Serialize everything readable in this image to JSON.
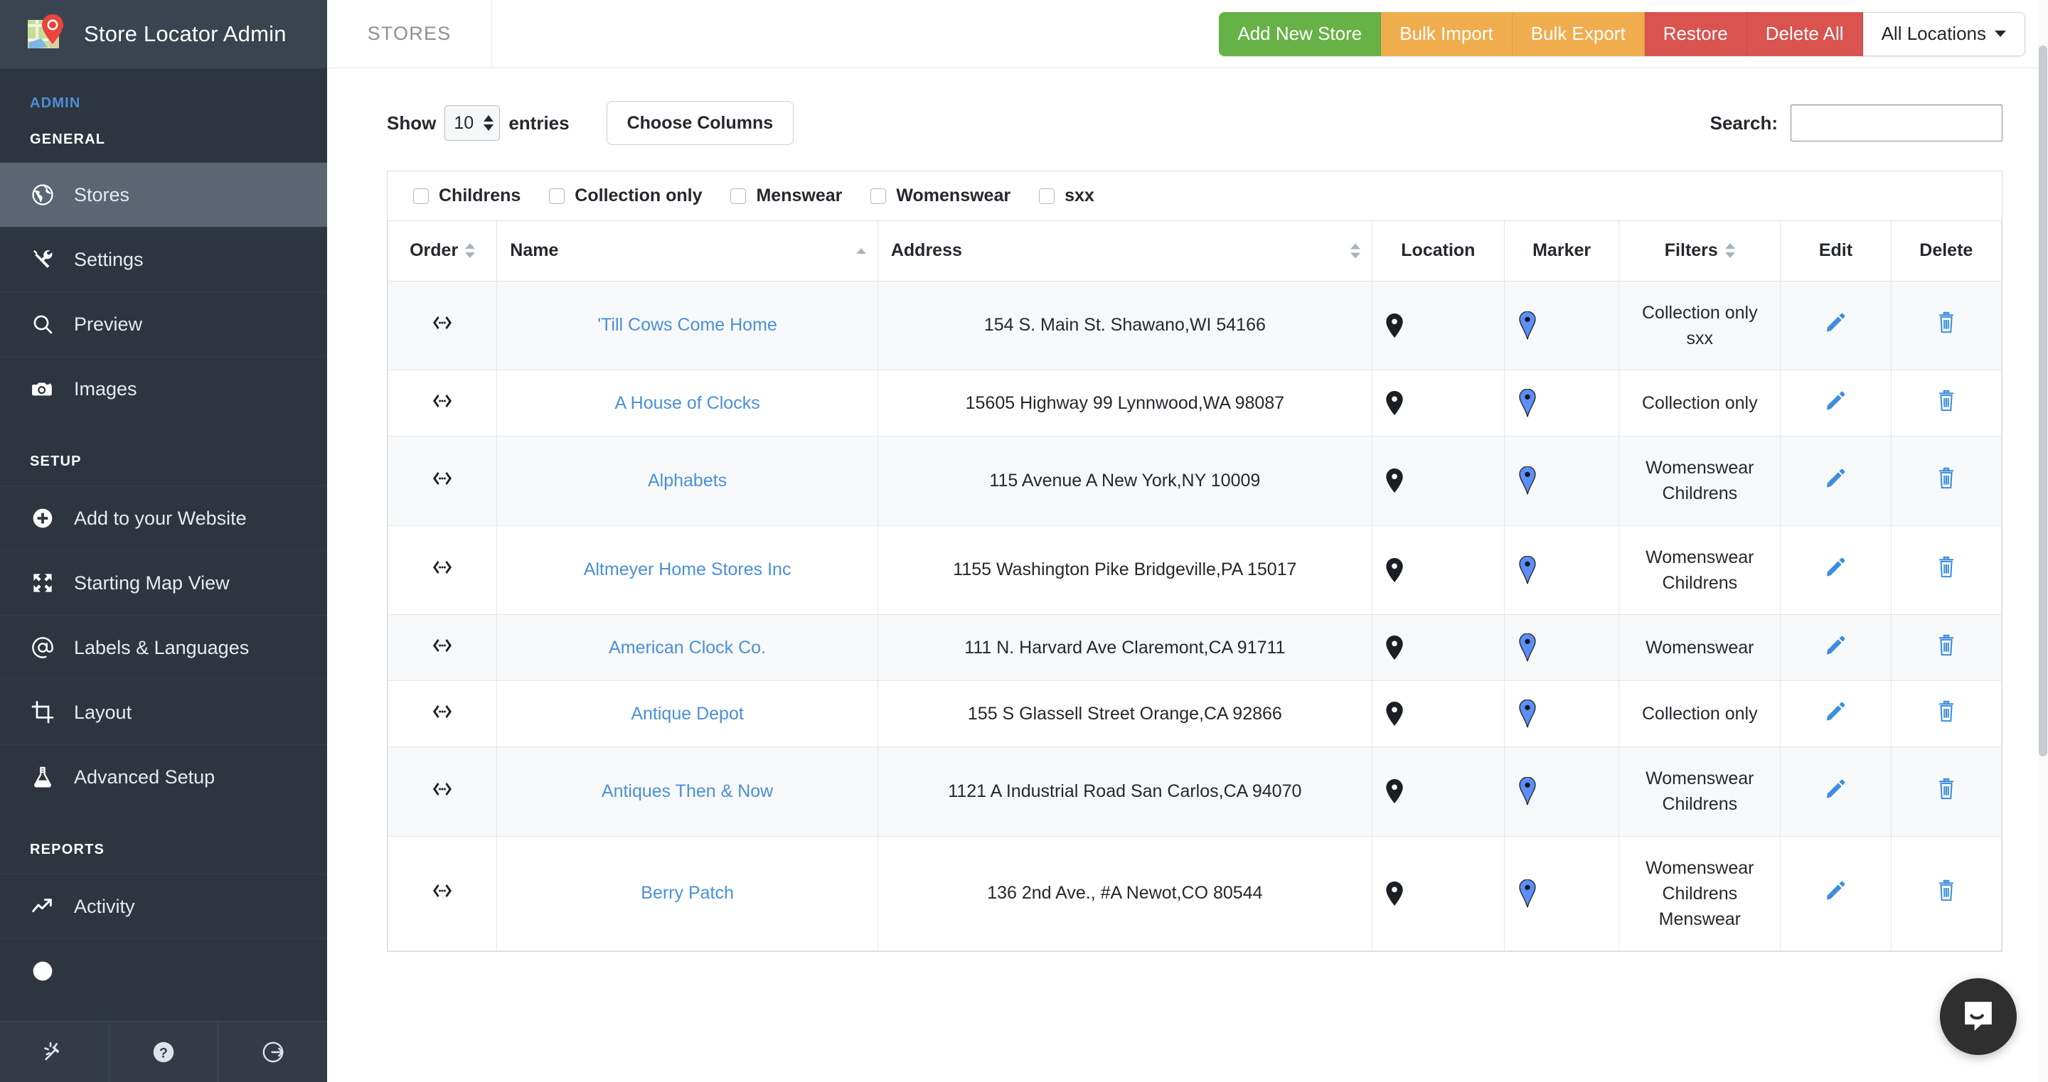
{
  "brand": {
    "title": "Store Locator Admin",
    "logo_icon": "map-pin-logo-icon"
  },
  "sidebar": {
    "sections": [
      {
        "heading": "ADMIN",
        "items": []
      },
      {
        "heading": "GENERAL",
        "items": [
          {
            "label": "Stores",
            "icon": "globe-icon",
            "active": true
          },
          {
            "label": "Settings",
            "icon": "tools-icon",
            "active": false
          },
          {
            "label": "Preview",
            "icon": "search-icon",
            "active": false
          },
          {
            "label": "Images",
            "icon": "camera-icon",
            "active": false
          }
        ]
      },
      {
        "heading": "SETUP",
        "items": [
          {
            "label": "Add to your Website",
            "icon": "plus-circle-icon",
            "active": false
          },
          {
            "label": "Starting Map View",
            "icon": "expand-arrows-icon",
            "active": false
          },
          {
            "label": "Labels & Languages",
            "icon": "at-sign-icon",
            "active": false
          },
          {
            "label": "Layout",
            "icon": "crop-icon",
            "active": false
          },
          {
            "label": "Advanced Setup",
            "icon": "flask-icon",
            "active": false
          }
        ]
      },
      {
        "heading": "REPORTS",
        "items": [
          {
            "label": "Activity",
            "icon": "trend-up-icon",
            "active": false
          }
        ]
      }
    ],
    "footer_buttons": [
      {
        "name": "magic-wand-icon"
      },
      {
        "name": "help-question-icon"
      },
      {
        "name": "logout-icon"
      }
    ]
  },
  "topbar": {
    "title": "STORES",
    "actions": [
      {
        "label": "Add New Store",
        "style": "green"
      },
      {
        "label": "Bulk Import",
        "style": "orange"
      },
      {
        "label": "Bulk Export",
        "style": "orange"
      },
      {
        "label": "Restore",
        "style": "red"
      },
      {
        "label": "Delete All",
        "style": "red"
      }
    ],
    "locations_dropdown": "All Locations"
  },
  "toolbar": {
    "show_label": "Show",
    "entries_value": "10",
    "entries_label": "entries",
    "choose_columns_label": "Choose Columns",
    "search_label": "Search:",
    "search_value": "",
    "search_placeholder": ""
  },
  "filters_bar": {
    "items": [
      {
        "label": "Childrens",
        "checked": false
      },
      {
        "label": "Collection only",
        "checked": false
      },
      {
        "label": "Menswear",
        "checked": false
      },
      {
        "label": "Womenswear",
        "checked": false
      },
      {
        "label": "sxx",
        "checked": false
      }
    ]
  },
  "table": {
    "columns": [
      {
        "label": "Order",
        "sortable": true,
        "sort": "none"
      },
      {
        "label": "Name",
        "sortable": true,
        "sort": "asc",
        "align": "left"
      },
      {
        "label": "Address",
        "sortable": true,
        "sort": "none",
        "align": "left"
      },
      {
        "label": "Location",
        "sortable": false,
        "sort": "none"
      },
      {
        "label": "Marker",
        "sortable": false,
        "sort": "none"
      },
      {
        "label": "Filters",
        "sortable": true,
        "sort": "none"
      },
      {
        "label": "Edit",
        "sortable": false,
        "sort": "none"
      },
      {
        "label": "Delete",
        "sortable": false,
        "sort": "none"
      }
    ],
    "rows": [
      {
        "name": "'Till Cows Come Home",
        "address": "154 S. Main St. Shawano,WI 54166",
        "filters": [
          "Collection only",
          "sxx"
        ]
      },
      {
        "name": "A House of Clocks",
        "address": "15605 Highway 99 Lynnwood,WA 98087",
        "filters": [
          "Collection only"
        ]
      },
      {
        "name": "Alphabets",
        "address": "115 Avenue A New York,NY 10009",
        "filters": [
          "Womenswear",
          "Childrens"
        ]
      },
      {
        "name": "Altmeyer Home Stores Inc",
        "address": "1155 Washington Pike Bridgeville,PA 15017",
        "filters": [
          "Womenswear",
          "Childrens"
        ]
      },
      {
        "name": "American Clock Co.",
        "address": "111 N. Harvard Ave Claremont,CA 91711",
        "filters": [
          "Womenswear"
        ]
      },
      {
        "name": "Antique Depot",
        "address": "155 S Glassell Street Orange,CA 92866",
        "filters": [
          "Collection only"
        ]
      },
      {
        "name": "Antiques Then & Now",
        "address": "1121 A Industrial Road San Carlos,CA 94070",
        "filters": [
          "Womenswear",
          "Childrens"
        ]
      },
      {
        "name": "Berry Patch",
        "address": "136 2nd Ave., #A Newot,CO 80544",
        "filters": [
          "Womenswear",
          "Childrens",
          "Menswear"
        ]
      }
    ],
    "row_icons": {
      "order": "drag-handle-icon",
      "location": "map-pin-black-icon",
      "marker": "map-pin-blue-icon",
      "edit": "pencil-icon",
      "delete": "trash-icon"
    }
  },
  "chat": {
    "icon": "chat-bubble-icon"
  },
  "colors": {
    "sidebar_bg": "#2f353e",
    "sidebar_brand_bg": "#3a4450",
    "sidebar_active": "#5b6574",
    "accent_blue": "#4a90d9",
    "green": "#67b246",
    "orange": "#f0ad4e",
    "red": "#d9534f",
    "admin_heading": "#4a90d9"
  }
}
